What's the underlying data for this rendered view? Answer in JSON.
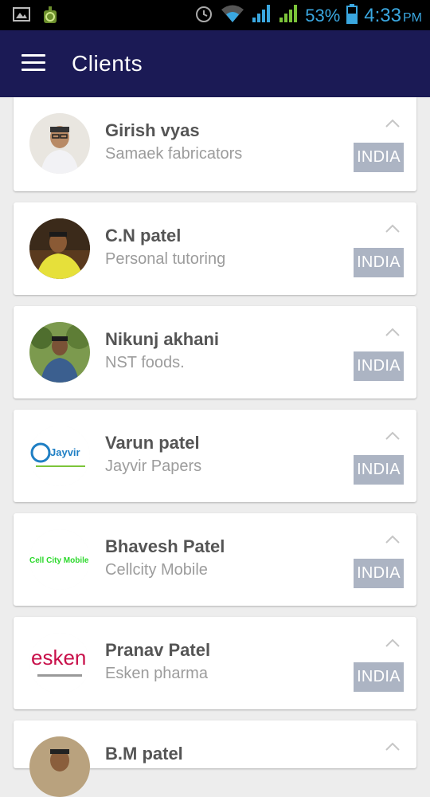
{
  "status_bar": {
    "battery": "53%",
    "time": "4:33",
    "ampm": "PM",
    "icons": [
      "gallery-icon",
      "android-icon",
      "alarm-icon",
      "wifi-icon",
      "signal-icon",
      "signal-icon",
      "battery-icon"
    ]
  },
  "app_bar": {
    "title": "Clients",
    "background": "#1b1a55"
  },
  "clients": [
    {
      "name": "Girish vyas",
      "company": "Samaek fabricators",
      "country": "INDIA"
    },
    {
      "name": "C.N patel",
      "company": "Personal tutoring",
      "country": "INDIA"
    },
    {
      "name": "Nikunj akhani",
      "company": "NST foods.",
      "country": "INDIA"
    },
    {
      "name": "Varun patel",
      "company": "Jayvir Papers",
      "country": "INDIA",
      "logo_text": "Jayvir"
    },
    {
      "name": "Bhavesh Patel",
      "company": "Cellcity Mobile",
      "country": "INDIA",
      "logo_text": "Cell City Mobile"
    },
    {
      "name": "Pranav Patel",
      "company": "Esken pharma",
      "country": "INDIA",
      "logo_text": "esken"
    },
    {
      "name": "B.M patel",
      "company": "",
      "country": ""
    }
  ],
  "colors": {
    "badge": "#acb4c3",
    "name_text": "#555555",
    "company_text": "#9c9c9c",
    "status_accent": "#3aa7e0"
  }
}
